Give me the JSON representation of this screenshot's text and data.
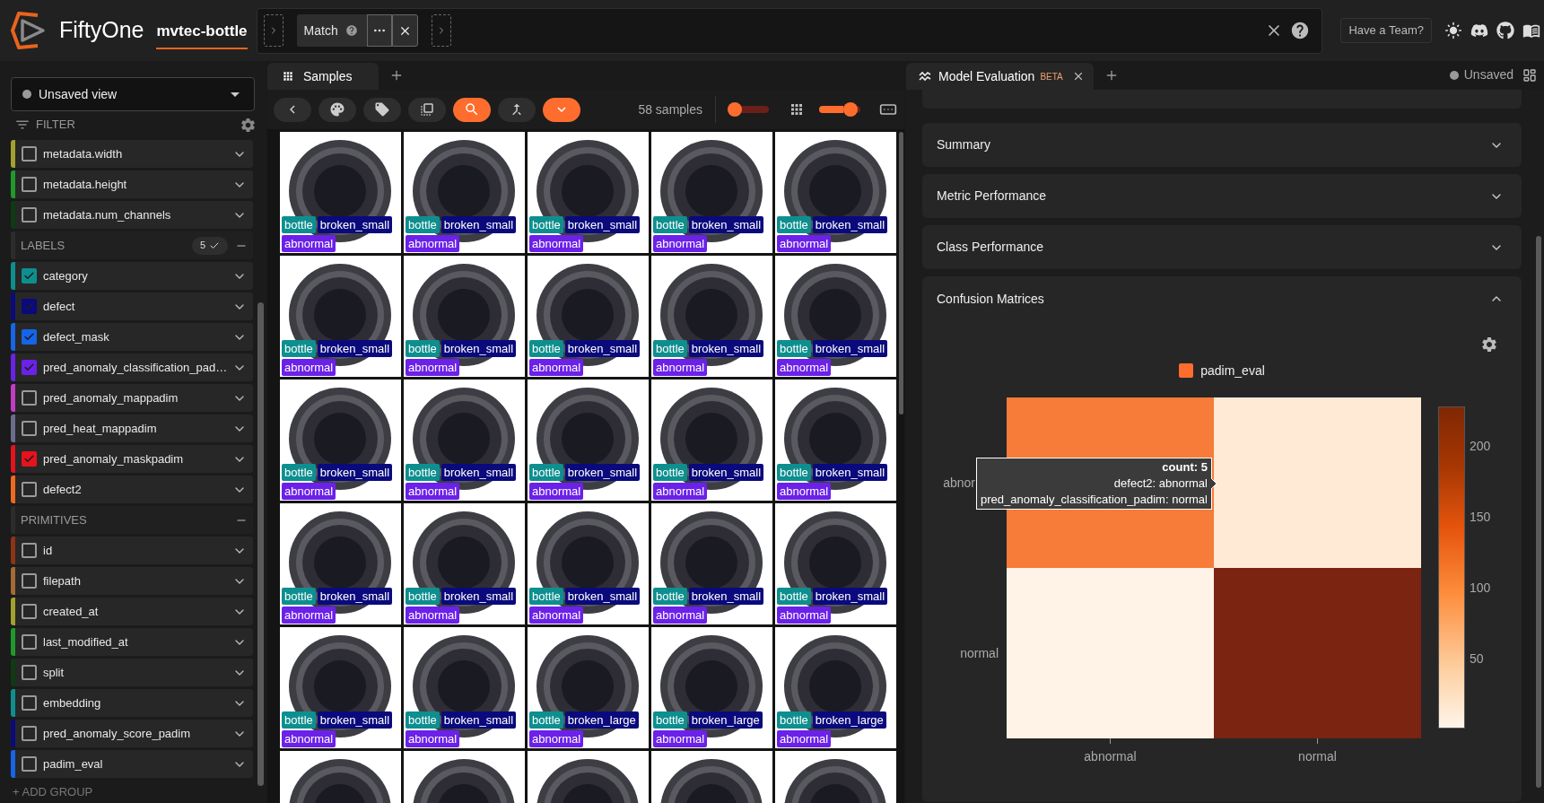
{
  "header": {
    "app_name": "FiftyOne",
    "dataset": "mvtec-bottle",
    "view_stages": [
      {
        "label": "Match"
      }
    ],
    "team_button": "Have a Team?"
  },
  "sidebar": {
    "view_selector": "Unsaved view",
    "filter_label": "FILTER",
    "groups": [
      {
        "items": [
          {
            "label": "metadata.width",
            "color": "#a3a12e",
            "checked": false
          },
          {
            "label": "metadata.height",
            "color": "#1f9a2a",
            "checked": false
          },
          {
            "label": "metadata.num_channels",
            "color": "#0e3b12",
            "checked": false
          }
        ]
      },
      {
        "title": "LABELS",
        "badge": "5",
        "items": [
          {
            "label": "category",
            "color": "#0e8f8f",
            "checked": true
          },
          {
            "label": "defect",
            "color": "#0a0a7d",
            "checked": true
          },
          {
            "label": "defect_mask",
            "color": "#1565e8",
            "checked": true
          },
          {
            "label": "pred_anomaly_classification_pad…",
            "color": "#6b21e8",
            "checked": true
          },
          {
            "label": "pred_anomaly_mappadim",
            "color": "#c23cc4",
            "checked": false
          },
          {
            "label": "pred_heat_mappadim",
            "color": "#6c6c8e",
            "checked": false
          },
          {
            "label": "pred_anomaly_maskpadim",
            "color": "#e6121e",
            "checked": true
          },
          {
            "label": "defect2",
            "color": "#ef6a20",
            "checked": false
          }
        ]
      },
      {
        "title": "PRIMITIVES",
        "items": [
          {
            "label": "id",
            "color": "#8c3414",
            "checked": false
          },
          {
            "label": "filepath",
            "color": "#a46c34",
            "checked": false
          },
          {
            "label": "created_at",
            "color": "#a3a12e",
            "checked": false
          },
          {
            "label": "last_modified_at",
            "color": "#1f9a2a",
            "checked": false
          },
          {
            "label": "split",
            "color": "#0e3b12",
            "checked": false
          },
          {
            "label": "embedding",
            "color": "#0e8f8f",
            "checked": false
          },
          {
            "label": "pred_anomaly_score_padim",
            "color": "#0a0a7d",
            "checked": false
          },
          {
            "label": "padim_eval",
            "color": "#1565e8",
            "checked": false
          }
        ]
      }
    ],
    "add_group": "+ ADD GROUP"
  },
  "samples_panel": {
    "tab": {
      "label": "Samples",
      "selected": true
    },
    "toolbar": {
      "buttons": [
        {
          "kind": "back",
          "active": false
        },
        {
          "kind": "palette",
          "active": false
        },
        {
          "kind": "tag",
          "active": false
        },
        {
          "kind": "select",
          "active": false
        },
        {
          "kind": "search",
          "active": true
        },
        {
          "kind": "merge",
          "active": false
        },
        {
          "kind": "expand",
          "active": true
        }
      ],
      "count": "58 samples",
      "sliders": [
        {
          "level": 0
        },
        {
          "level": 0.9
        }
      ]
    },
    "samples": [
      {
        "kind": "photo",
        "tags": [
          {
            "text": "bottle",
            "color": "#0e8f8f"
          },
          {
            "text": "broken_small",
            "color": "#0a0a7d"
          },
          {
            "text": "abnormal",
            "color": "#6b21e8"
          }
        ]
      },
      {
        "kind": "photo",
        "tags": [
          {
            "text": "bottle",
            "color": "#0e8f8f"
          },
          {
            "text": "broken_small",
            "color": "#0a0a7d"
          },
          {
            "text": "abnormal",
            "color": "#6b21e8"
          }
        ]
      },
      {
        "kind": "photo",
        "tags": [
          {
            "text": "bottle",
            "color": "#0e8f8f"
          },
          {
            "text": "broken_small",
            "color": "#0a0a7d"
          },
          {
            "text": "abnormal",
            "color": "#6b21e8"
          }
        ]
      },
      {
        "kind": "photo",
        "tags": [
          {
            "text": "bottle",
            "color": "#0e8f8f"
          },
          {
            "text": "broken_small",
            "color": "#0a0a7d"
          },
          {
            "text": "abnormal",
            "color": "#6b21e8"
          }
        ]
      },
      {
        "kind": "photo",
        "tags": [
          {
            "text": "bottle",
            "color": "#0e8f8f"
          },
          {
            "text": "broken_small",
            "color": "#0a0a7d"
          },
          {
            "text": "abnormal",
            "color": "#6b21e8"
          }
        ]
      },
      {
        "kind": "photo",
        "tags": [
          {
            "text": "bottle",
            "color": "#0e8f8f"
          },
          {
            "text": "broken_small",
            "color": "#0a0a7d"
          },
          {
            "text": "abnormal",
            "color": "#6b21e8"
          }
        ]
      },
      {
        "kind": "photo",
        "tags": [
          {
            "text": "bottle",
            "color": "#0e8f8f"
          },
          {
            "text": "broken_small",
            "color": "#0a0a7d"
          },
          {
            "text": "abnormal",
            "color": "#6b21e8"
          }
        ]
      },
      {
        "kind": "photo",
        "tags": [
          {
            "text": "bottle",
            "color": "#0e8f8f"
          },
          {
            "text": "broken_small",
            "color": "#0a0a7d"
          },
          {
            "text": "abnormal",
            "color": "#6b21e8"
          }
        ]
      },
      {
        "kind": "photo",
        "tags": [
          {
            "text": "bottle",
            "color": "#0e8f8f"
          },
          {
            "text": "broken_small",
            "color": "#0a0a7d"
          },
          {
            "text": "abnormal",
            "color": "#6b21e8"
          }
        ]
      },
      {
        "kind": "photo",
        "tags": [
          {
            "text": "bottle",
            "color": "#0e8f8f"
          },
          {
            "text": "broken_small",
            "color": "#0a0a7d"
          },
          {
            "text": "abnormal",
            "color": "#6b21e8"
          }
        ]
      },
      {
        "kind": "photo",
        "tags": [
          {
            "text": "bottle",
            "color": "#0e8f8f"
          },
          {
            "text": "broken_small",
            "color": "#0a0a7d"
          },
          {
            "text": "abnormal",
            "color": "#6b21e8"
          }
        ]
      },
      {
        "kind": "photo",
        "tags": [
          {
            "text": "bottle",
            "color": "#0e8f8f"
          },
          {
            "text": "broken_small",
            "color": "#0a0a7d"
          },
          {
            "text": "abnormal",
            "color": "#6b21e8"
          }
        ]
      },
      {
        "kind": "photo",
        "tags": [
          {
            "text": "bottle",
            "color": "#0e8f8f"
          },
          {
            "text": "broken_small",
            "color": "#0a0a7d"
          },
          {
            "text": "abnormal",
            "color": "#6b21e8"
          }
        ]
      },
      {
        "kind": "photo",
        "tags": [
          {
            "text": "bottle",
            "color": "#0e8f8f"
          },
          {
            "text": "broken_small",
            "color": "#0a0a7d"
          },
          {
            "text": "abnormal",
            "color": "#6b21e8"
          }
        ]
      },
      {
        "kind": "photo",
        "tags": [
          {
            "text": "bottle",
            "color": "#0e8f8f"
          },
          {
            "text": "broken_small",
            "color": "#0a0a7d"
          },
          {
            "text": "abnormal",
            "color": "#6b21e8"
          }
        ]
      },
      {
        "kind": "photo",
        "tags": [
          {
            "text": "bottle",
            "color": "#0e8f8f"
          },
          {
            "text": "broken_small",
            "color": "#0a0a7d"
          },
          {
            "text": "abnormal",
            "color": "#6b21e8"
          }
        ]
      },
      {
        "kind": "photo",
        "tags": [
          {
            "text": "bottle",
            "color": "#0e8f8f"
          },
          {
            "text": "broken_small",
            "color": "#0a0a7d"
          },
          {
            "text": "abnormal",
            "color": "#6b21e8"
          }
        ]
      },
      {
        "kind": "photo",
        "tags": [
          {
            "text": "bottle",
            "color": "#0e8f8f"
          },
          {
            "text": "broken_small",
            "color": "#0a0a7d"
          },
          {
            "text": "abnormal",
            "color": "#6b21e8"
          }
        ]
      },
      {
        "kind": "photo",
        "tags": [
          {
            "text": "bottle",
            "color": "#0e8f8f"
          },
          {
            "text": "broken_small",
            "color": "#0a0a7d"
          },
          {
            "text": "abnormal",
            "color": "#6b21e8"
          }
        ]
      },
      {
        "kind": "photo",
        "tags": [
          {
            "text": "bottle",
            "color": "#0e8f8f"
          },
          {
            "text": "broken_small",
            "color": "#0a0a7d"
          },
          {
            "text": "abnormal",
            "color": "#6b21e8"
          }
        ]
      },
      {
        "kind": "photo",
        "tags": [
          {
            "text": "bottle",
            "color": "#0e8f8f"
          },
          {
            "text": "broken_small",
            "color": "#0a0a7d"
          },
          {
            "text": "abnormal",
            "color": "#6b21e8"
          }
        ]
      },
      {
        "kind": "photo",
        "tags": [
          {
            "text": "bottle",
            "color": "#0e8f8f"
          },
          {
            "text": "broken_small",
            "color": "#0a0a7d"
          },
          {
            "text": "abnormal",
            "color": "#6b21e8"
          }
        ]
      },
      {
        "kind": "photo",
        "tags": [
          {
            "text": "bottle",
            "color": "#0e8f8f"
          },
          {
            "text": "broken_large",
            "color": "#0a0a7d"
          },
          {
            "text": "abnormal",
            "color": "#6b21e8"
          }
        ]
      },
      {
        "kind": "photo",
        "tags": [
          {
            "text": "bottle",
            "color": "#0e8f8f"
          },
          {
            "text": "broken_large",
            "color": "#0a0a7d"
          },
          {
            "text": "abnormal",
            "color": "#6b21e8"
          }
        ]
      },
      {
        "kind": "photo",
        "tags": [
          {
            "text": "bottle",
            "color": "#0e8f8f"
          },
          {
            "text": "broken_large",
            "color": "#0a0a7d"
          },
          {
            "text": "abnormal",
            "color": "#6b21e8"
          }
        ]
      },
      {
        "kind": "photo"
      },
      {
        "kind": "photo"
      },
      {
        "kind": "photo"
      },
      {
        "kind": "photo"
      },
      {
        "kind": "photo"
      }
    ]
  },
  "eval_panel": {
    "tab": {
      "label": "Model Evaluation",
      "badge": "BETA",
      "selected": true
    },
    "status": "Unsaved",
    "sections": [
      {
        "title": "Summary",
        "expanded": false
      },
      {
        "title": "Metric Performance",
        "expanded": false
      },
      {
        "title": "Class Performance",
        "expanded": false
      },
      {
        "title": "Confusion Matrices",
        "expanded": true,
        "matrix": {
          "legend": "padim_eval",
          "y_labels": [
            "abnor",
            "normal"
          ],
          "x_labels": [
            "abnormal",
            "normal"
          ],
          "cells": [
            [
              {
                "color": "#f77b39"
              },
              {
                "color": "#feead5"
              }
            ],
            [
              {
                "color": "#fff3e7"
              },
              {
                "color": "#7a2411"
              }
            ]
          ],
          "colorbar_ticks": [
            "200",
            "150",
            "100",
            "50"
          ],
          "tooltip": {
            "title": "count: 5",
            "lines": [
              "defect2: abnormal",
              "pred_anomaly_classification_padim: normal"
            ]
          }
        }
      }
    ]
  }
}
